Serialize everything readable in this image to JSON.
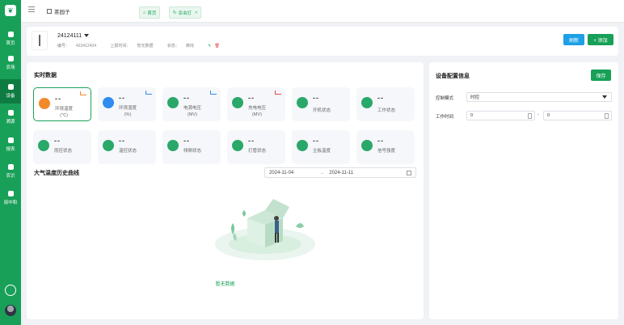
{
  "sidebar": {
    "items": [
      {
        "label": "首页"
      },
      {
        "label": "农场"
      },
      {
        "label": "设备"
      },
      {
        "label": "溯源"
      },
      {
        "label": "报表"
      },
      {
        "label": "农识"
      },
      {
        "label": "丽中和"
      }
    ]
  },
  "topbar": {
    "farm_name": "茶园子",
    "tabs": [
      {
        "label": "首页"
      },
      {
        "label": "杀虫灯"
      }
    ],
    "close_glyph": "×"
  },
  "device": {
    "name": "24124111",
    "meta": {
      "id_label": "编号：",
      "id_value": "423412424",
      "report_label": "上报时间：",
      "report_value": "暂无数据",
      "status_label": "状态：",
      "status_value": "离线"
    },
    "refresh_label": "刷新",
    "add_label": "+ 添加"
  },
  "realtime": {
    "title": "实时数据",
    "cards": [
      {
        "value": "--",
        "label": "环境温度\n(℃)",
        "color": "#f28a2c"
      },
      {
        "value": "--",
        "label": "环境湿度\n(%)",
        "color": "#2f8cf0"
      },
      {
        "value": "--",
        "label": "电源电压\n(MV)",
        "color": "#2aa86a"
      },
      {
        "value": "--",
        "label": "充电电压\n(MV)",
        "color": "#2aa86a"
      },
      {
        "value": "--",
        "label": "开机状态",
        "color": "#2aa86a"
      },
      {
        "value": "--",
        "label": "工作状态",
        "color": "#2aa86a"
      },
      {
        "value": "--",
        "label": "雨控状态",
        "color": "#2aa86a"
      },
      {
        "value": "--",
        "label": "温控状态",
        "color": "#2aa86a"
      },
      {
        "value": "--",
        "label": "倾倒状态",
        "color": "#2aa86a"
      },
      {
        "value": "--",
        "label": "灯管状态",
        "color": "#2aa86a"
      },
      {
        "value": "--",
        "label": "主板温度",
        "color": "#2aa86a"
      },
      {
        "value": "--",
        "label": "信号强度",
        "color": "#2aa86a"
      }
    ]
  },
  "history": {
    "title": "大气温度历史曲线",
    "start_date": "2024-11-04",
    "separator": "→",
    "end_date": "2024-11-11",
    "empty_text": "暂无数据"
  },
  "config": {
    "title": "设备配置信息",
    "save_label": "保存",
    "control_mode_label": "控制模式",
    "control_mode_value": "时控",
    "work_time_label": "工作时间",
    "time_start": "0",
    "time_sep": "-",
    "time_end": "0"
  },
  "colors": {
    "brand": "#18a058",
    "blue": "#1ea0e6"
  }
}
